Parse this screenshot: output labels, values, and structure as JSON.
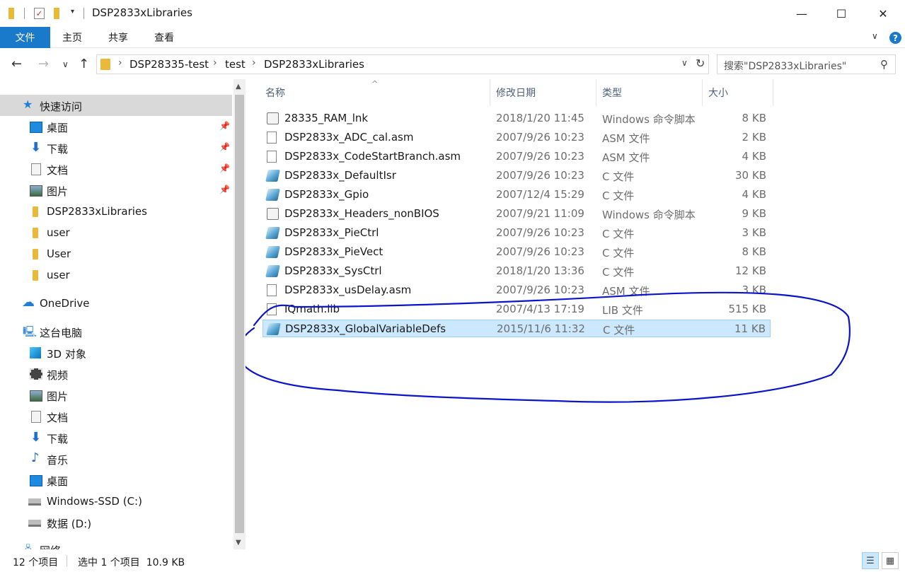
{
  "window": {
    "title": "DSP2833xLibraries",
    "minimize": "—",
    "maximize": "☐",
    "close": "✕"
  },
  "ribbon": {
    "tabs": [
      "文件",
      "主页",
      "共享",
      "查看"
    ],
    "expand": "∨",
    "help": "?"
  },
  "nav": {
    "back": "←",
    "forward": "→",
    "recent": "∨",
    "up": "↑",
    "breadcrumb": [
      "DSP28335-test",
      "test",
      "DSP2833xLibraries"
    ],
    "crumb_sep": "›",
    "dropdown": "∨",
    "refresh": "↻",
    "search_placeholder": "搜索\"DSP2833xLibraries\"",
    "search_icon": "⚲"
  },
  "sidebar": {
    "pin": "📌",
    "items": [
      {
        "label": "快速访问",
        "icon": "star-icon",
        "selected": true
      },
      {
        "label": "桌面",
        "icon": "desktop-icon",
        "pinned": true
      },
      {
        "label": "下载",
        "icon": "download-icon",
        "pinned": true
      },
      {
        "label": "文档",
        "icon": "document-icon",
        "pinned": true
      },
      {
        "label": "图片",
        "icon": "picture-icon",
        "pinned": true
      },
      {
        "label": "DSP2833xLibraries",
        "icon": "folder-icon"
      },
      {
        "label": "user",
        "icon": "folder-icon"
      },
      {
        "label": "User",
        "icon": "folder-icon"
      },
      {
        "label": "user",
        "icon": "folder-icon"
      },
      {
        "label": "OneDrive",
        "icon": "onedrive-icon"
      },
      {
        "label": "这台电脑",
        "icon": "this-pc-icon"
      },
      {
        "label": "3D 对象",
        "icon": "3d-objects-icon"
      },
      {
        "label": "视频",
        "icon": "video-icon"
      },
      {
        "label": "图片",
        "icon": "picture-icon"
      },
      {
        "label": "文档",
        "icon": "document-icon"
      },
      {
        "label": "下载",
        "icon": "download-icon"
      },
      {
        "label": "音乐",
        "icon": "music-icon"
      },
      {
        "label": "桌面",
        "icon": "desktop-icon"
      },
      {
        "label": "Windows-SSD (C:)",
        "icon": "drive-c-icon"
      },
      {
        "label": "数据 (D:)",
        "icon": "drive-d-icon"
      },
      {
        "label": "网络",
        "icon": "network-icon"
      }
    ]
  },
  "columns": {
    "name": "名称",
    "date": "修改日期",
    "type": "类型",
    "size": "大小",
    "sort_arrow": "^"
  },
  "files": [
    {
      "name": "28335_RAM_lnk",
      "date": "2018/1/20 11:45",
      "type": "Windows 命令脚本",
      "size": "8 KB",
      "icon": "script-file-icon"
    },
    {
      "name": "DSP2833x_ADC_cal.asm",
      "date": "2007/9/26 10:23",
      "type": "ASM 文件",
      "size": "2 KB",
      "icon": "blank-file-icon"
    },
    {
      "name": "DSP2833x_CodeStartBranch.asm",
      "date": "2007/9/26 10:23",
      "type": "ASM 文件",
      "size": "4 KB",
      "icon": "blank-file-icon"
    },
    {
      "name": "DSP2833x_DefaultIsr",
      "date": "2007/9/26 10:23",
      "type": "C 文件",
      "size": "30 KB",
      "icon": "c-file-icon"
    },
    {
      "name": "DSP2833x_Gpio",
      "date": "2007/12/4 15:29",
      "type": "C 文件",
      "size": "4 KB",
      "icon": "c-file-icon"
    },
    {
      "name": "DSP2833x_Headers_nonBIOS",
      "date": "2007/9/21 11:09",
      "type": "Windows 命令脚本",
      "size": "9 KB",
      "icon": "script-file-icon"
    },
    {
      "name": "DSP2833x_PieCtrl",
      "date": "2007/9/26 10:23",
      "type": "C 文件",
      "size": "3 KB",
      "icon": "c-file-icon"
    },
    {
      "name": "DSP2833x_PieVect",
      "date": "2007/9/26 10:23",
      "type": "C 文件",
      "size": "8 KB",
      "icon": "c-file-icon"
    },
    {
      "name": "DSP2833x_SysCtrl",
      "date": "2018/1/20 13:36",
      "type": "C 文件",
      "size": "12 KB",
      "icon": "c-file-icon"
    },
    {
      "name": "DSP2833x_usDelay.asm",
      "date": "2007/9/26 10:23",
      "type": "ASM 文件",
      "size": "3 KB",
      "icon": "blank-file-icon"
    },
    {
      "name": "IQmath.lib",
      "date": "2007/4/13 17:19",
      "type": "LIB 文件",
      "size": "515 KB",
      "icon": "blank-file-icon"
    },
    {
      "name": "DSP2833x_GlobalVariableDefs",
      "date": "2015/11/6 11:32",
      "type": "C 文件",
      "size": "11 KB",
      "icon": "c-file-icon",
      "selected": true
    }
  ],
  "annotation_color": "#0a14c8",
  "status": {
    "count": "12 个项目",
    "selection": "选中 1 个项目  10.9 KB",
    "details_view": "☰",
    "icons_view": "▦"
  }
}
